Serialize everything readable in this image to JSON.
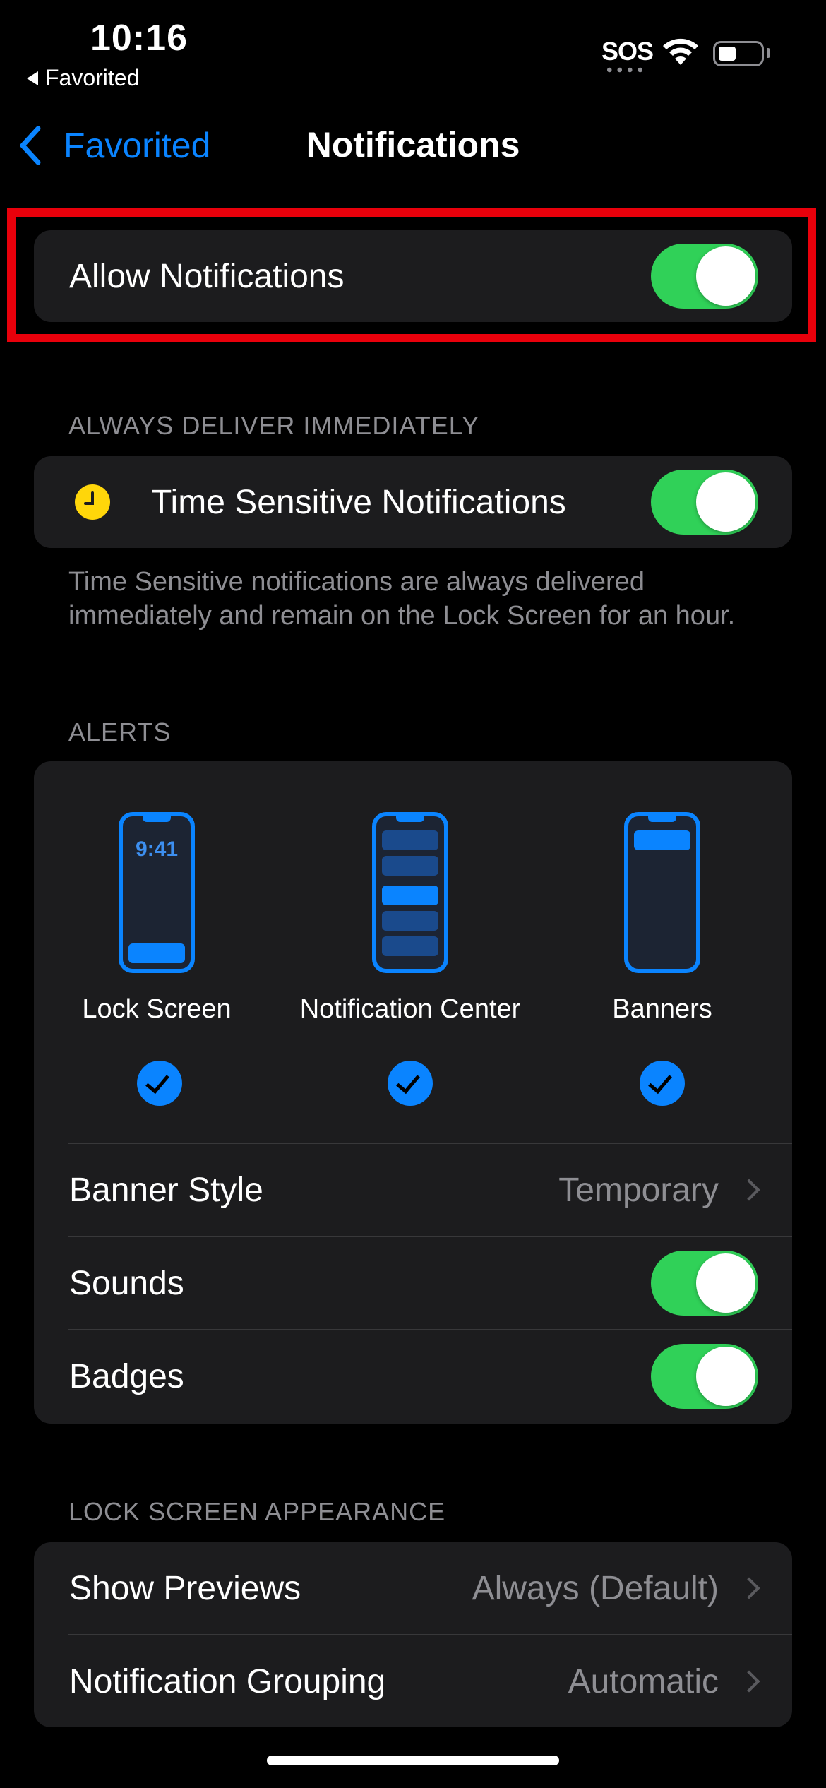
{
  "status_bar": {
    "time": "10:16",
    "back_app": "Favorited",
    "carrier": "SOS"
  },
  "nav": {
    "back_label": "Favorited",
    "title": "Notifications"
  },
  "allow_notifications": {
    "label": "Allow Notifications",
    "enabled": true
  },
  "deliver_section": {
    "header": "ALWAYS DELIVER IMMEDIATELY",
    "time_sensitive_label": "Time Sensitive Notifications",
    "time_sensitive_enabled": true,
    "footer": "Time Sensitive notifications are always delivered immediately and remain on the Lock Screen for an hour."
  },
  "alerts_section": {
    "header": "ALERTS",
    "options": [
      {
        "label": "Lock Screen",
        "preview_time": "9:41",
        "checked": true
      },
      {
        "label": "Notification Center",
        "checked": true
      },
      {
        "label": "Banners",
        "checked": true
      }
    ],
    "banner_style_label": "Banner Style",
    "banner_style_value": "Temporary",
    "sounds_label": "Sounds",
    "sounds_enabled": true,
    "badges_label": "Badges",
    "badges_enabled": true
  },
  "lock_screen_section": {
    "header": "LOCK SCREEN APPEARANCE",
    "show_previews_label": "Show Previews",
    "show_previews_value": "Always (Default)",
    "grouping_label": "Notification Grouping",
    "grouping_value": "Automatic"
  },
  "colors": {
    "accent": "#0a84ff",
    "toggle_on": "#30d158",
    "highlight": "#e8000b",
    "clock_icon": "#ffd60a"
  }
}
